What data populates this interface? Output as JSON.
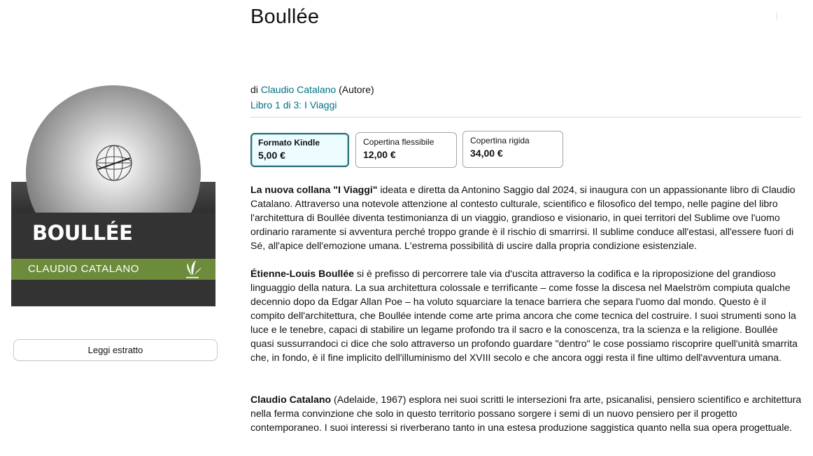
{
  "product": {
    "title": "Boullée",
    "byline_prefix": "di",
    "author": "Claudio Catalano",
    "author_role": "(Autore)",
    "series": "Libro 1 di 3: I Viaggi"
  },
  "cover": {
    "title": "BOULLÉE",
    "author": "CLAUDIO CATALANO",
    "colors": {
      "dark_band": "#333333",
      "green_band": "#6c8c3b"
    }
  },
  "leggi_estratto": "Leggi estratto",
  "formats": [
    {
      "label": "Formato Kindle",
      "price": "5,00 €",
      "selected": true
    },
    {
      "label": "Copertina flessibile",
      "price": "12,00 €",
      "selected": false
    },
    {
      "label": "Copertina rigida",
      "price": "34,00 €",
      "selected": false
    }
  ],
  "description": {
    "p1_bold": "La nuova collana \"I Viaggi\"",
    "p1_text": " ideata e diretta da Antonino Saggio dal 2024, si inaugura con un appassionante libro di Claudio Catalano. Attraverso una notevole attenzione al contesto culturale, scientifico e filosofico del tempo, nelle pagine del libro l'architettura di Boullée diventa testimonianza di un viaggio, grandioso e visionario, in quei territori del Sublime ove l'uomo ordinario raramente si avventura perché troppo grande è il rischio di smarrirsi. Il sublime conduce all'estasi, all'essere fuori di Sé, all'apice dell'emozione umana. L'estrema possibilità di uscire dalla propria condizione esistenziale.",
    "p2_bold": "Étienne-Louis Boullée",
    "p2_text": " si è prefisso di percorrere tale via d'uscita attraverso la codifica e la riproposizione del grandioso linguaggio della natura. La sua architettura colossale e terrificante – come fosse la discesa nel Maelström compiuta qualche decennio dopo da Edgar Allan Poe – ha voluto squarciare la tenace barriera che separa l'uomo dal mondo. Questo è il compito dell'architettura, che Boullée intende come arte prima ancora che come tecnica del costruire. I suoi strumenti sono la luce e le tenebre, capaci di stabilire un legame profondo tra il sacro e la conoscenza, tra la scienza e la religione. Boullée quasi sussurrandoci ci dice che solo attraverso un profondo guardare \"dentro\" le cose possiamo riscoprire quell'unità smarrita che, in fondo, è il fine implicito dell'illuminismo del XVIII secolo e che ancora oggi resta il fine ultimo dell'avventura umana.",
    "p3_bold": "Claudio Catalano",
    "p3_text": " (Adelaide, 1967) esplora nei suoi scritti le intersezioni fra arte, psicanalisi, pensiero scientifico e architettura nella ferma convinzione che solo in questo territorio possano sorgere i semi di un nuovo pensiero per il progetto contemporaneo. I suoi interessi si riverberano tanto in una estesa produzione saggistica quanto nella sua opera progettuale."
  },
  "icons": [
    "globe-icon",
    "leaf-logo-icon"
  ]
}
